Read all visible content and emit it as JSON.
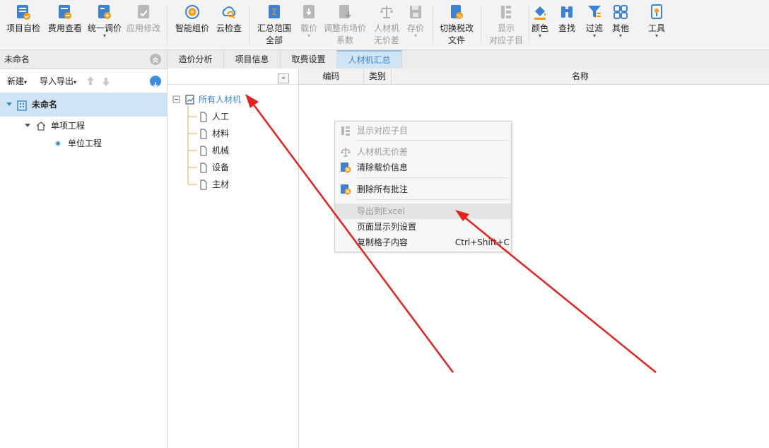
{
  "toolbar": {
    "items": [
      {
        "l1": "项目自检"
      },
      {
        "l1": "费用查看"
      },
      {
        "l1": "统一调价",
        "arrow": "▾"
      },
      {
        "l1": "应用修改"
      },
      {
        "l1": "智能组价"
      },
      {
        "l1": "云检查"
      },
      {
        "l1": "汇总范围",
        "l2": "全部"
      },
      {
        "l1": "载价",
        "arrow": "▾"
      },
      {
        "l1": "调整市场价",
        "l2": "系数"
      },
      {
        "l1": "人材机",
        "l2": "无价差"
      },
      {
        "l1": "存价",
        "arrow": "▾"
      },
      {
        "l1": "切换税改",
        "l2": "文件"
      },
      {
        "l1": "显示",
        "l2": "对应子目"
      },
      {
        "l1": "颜色",
        "arrow": "▾"
      },
      {
        "l1": "查找"
      },
      {
        "l1": "过滤",
        "arrow": "▾"
      },
      {
        "l1": "其他",
        "arrow": "▾"
      },
      {
        "l1": "工具",
        "arrow": "▾"
      }
    ]
  },
  "left": {
    "title": "未命名",
    "new_label": "新建",
    "import_export_label": "导入导出",
    "tree": {
      "root": "未命名",
      "single": "单项工程",
      "unit": "单位工程"
    }
  },
  "tabs": [
    "造价分析",
    "项目信息",
    "取费设置",
    "人材机汇总"
  ],
  "mid_tree": {
    "root": "所有人材机",
    "children": [
      "人工",
      "材料",
      "机械",
      "设备",
      "主材"
    ]
  },
  "grid": {
    "columns": [
      "编码",
      "类别",
      "名称"
    ]
  },
  "menu": {
    "items": [
      {
        "label": "显示对应子目"
      },
      {
        "label": "人材机无价差"
      },
      {
        "label": "清除载价信息"
      },
      {
        "label": "删除所有批注"
      },
      {
        "label": "导出到Excel"
      },
      {
        "label": "页面显示列设置"
      },
      {
        "label": "复制格子内容",
        "shortcut": "Ctrl+Shift+C"
      }
    ]
  },
  "colors": {
    "accent": "#3a86c8",
    "selection": "#cfe5f6",
    "annotation_arrow": "#e8201c"
  }
}
